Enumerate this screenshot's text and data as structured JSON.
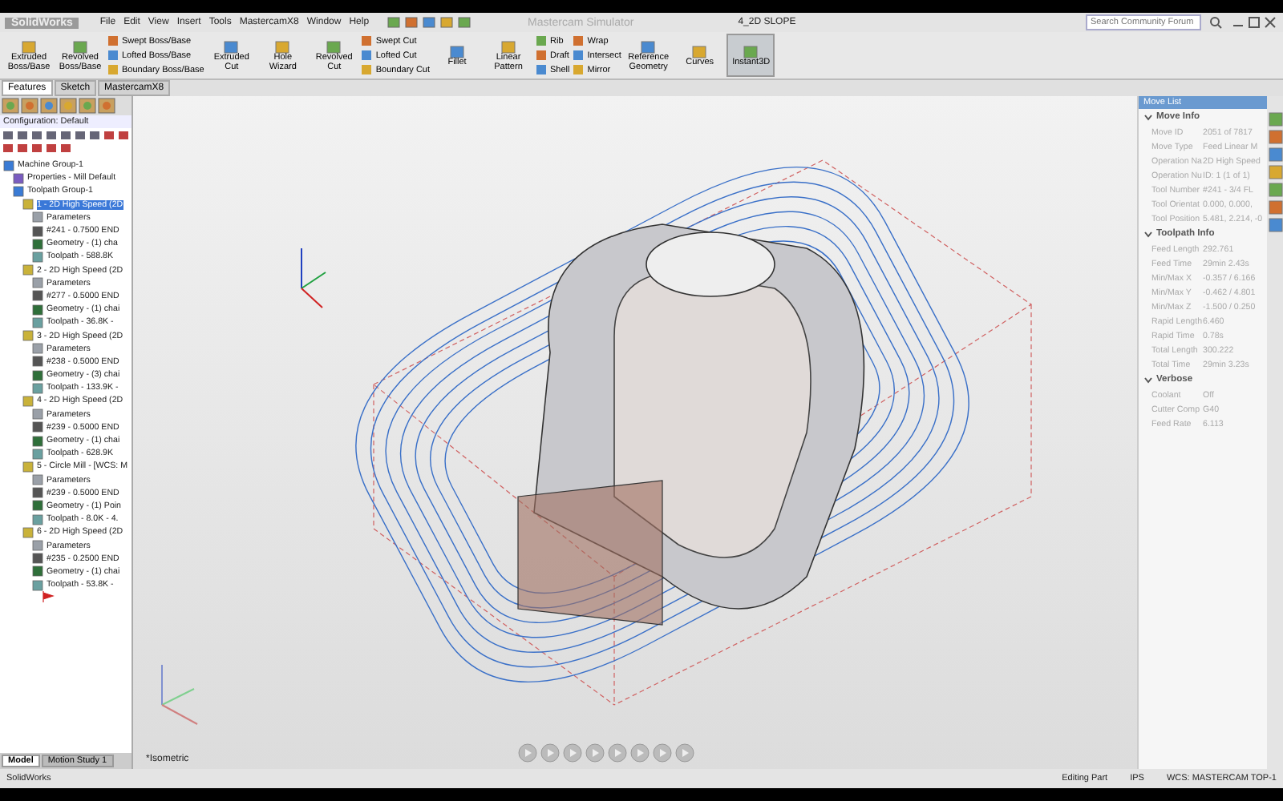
{
  "title_bar": {
    "logo": "SolidWorks",
    "menu": [
      "File",
      "Edit",
      "View",
      "Insert",
      "Tools",
      "MastercamX8",
      "Window",
      "Help"
    ],
    "app_title": "Mastercam Simulator",
    "document": "4_2D SLOPE",
    "search": {
      "placeholder": "Search Community Forum"
    }
  },
  "ribbon": [
    {
      "kind": "large",
      "label": "Extruded Boss/Base",
      "pressed": false
    },
    {
      "kind": "large",
      "label": "Revolved Boss/Base",
      "pressed": false
    },
    {
      "kind": "stack",
      "items": [
        "Swept Boss/Base",
        "Lofted Boss/Base",
        "Boundary Boss/Base"
      ]
    },
    {
      "kind": "large",
      "label": "Extruded Cut",
      "pressed": false
    },
    {
      "kind": "large",
      "label": "Hole Wizard",
      "pressed": false
    },
    {
      "kind": "large",
      "label": "Revolved Cut",
      "pressed": false
    },
    {
      "kind": "stack",
      "items": [
        "Swept Cut",
        "Lofted Cut",
        "Boundary Cut"
      ]
    },
    {
      "kind": "large",
      "label": "Fillet",
      "pressed": false
    },
    {
      "kind": "large",
      "label": "Linear Pattern",
      "pressed": false
    },
    {
      "kind": "stack",
      "items": [
        "Rib",
        "Draft",
        "Shell"
      ]
    },
    {
      "kind": "stack",
      "items": [
        "Wrap",
        "Intersect",
        "Mirror"
      ]
    },
    {
      "kind": "large",
      "label": "Reference Geometry",
      "pressed": false
    },
    {
      "kind": "large",
      "label": "Curves",
      "pressed": false
    },
    {
      "kind": "large",
      "label": "Instant3D",
      "pressed": true
    }
  ],
  "tabs": [
    {
      "label": "Features",
      "selected": true
    },
    {
      "label": "Sketch",
      "selected": false
    },
    {
      "label": "MastercamX8",
      "selected": false
    }
  ],
  "left_panel": {
    "configuration": "Configuration: Default",
    "tree": [
      {
        "kind": "group",
        "label": "Machine Group-1",
        "selected": false,
        "children": [
          {
            "kind": "properties",
            "label": "Properties - Mill Default",
            "selected": false
          },
          {
            "kind": "group",
            "label": "Toolpath Group-1",
            "selected": false,
            "children": [
              {
                "kind": "operation",
                "label": "1 - 2D High Speed (2D",
                "selected": true,
                "children": [
                  {
                    "kind": "parameters",
                    "label": "Parameters",
                    "selected": false
                  },
                  {
                    "kind": "tool",
                    "label": "#241 - 0.7500 END",
                    "selected": false
                  },
                  {
                    "kind": "geometry",
                    "label": "Geometry - (1) cha",
                    "selected": false
                  },
                  {
                    "kind": "toolpath",
                    "label": "Toolpath - 588.8K",
                    "selected": false
                  }
                ]
              },
              {
                "kind": "operation",
                "label": "2 - 2D High Speed (2D",
                "selected": false,
                "children": [
                  {
                    "kind": "parameters",
                    "label": "Parameters",
                    "selected": false
                  },
                  {
                    "kind": "tool",
                    "label": "#277 - 0.5000 END",
                    "selected": false
                  },
                  {
                    "kind": "geometry",
                    "label": "Geometry - (1) chai",
                    "selected": false
                  },
                  {
                    "kind": "toolpath",
                    "label": "Toolpath - 36.8K -",
                    "selected": false
                  }
                ]
              },
              {
                "kind": "operation",
                "label": "3 - 2D High Speed (2D",
                "selected": false,
                "children": [
                  {
                    "kind": "parameters",
                    "label": "Parameters",
                    "selected": false
                  },
                  {
                    "kind": "tool",
                    "label": "#238 - 0.5000 END",
                    "selected": false
                  },
                  {
                    "kind": "geometry",
                    "label": "Geometry - (3) chai",
                    "selected": false
                  },
                  {
                    "kind": "toolpath",
                    "label": "Toolpath - 133.9K -",
                    "selected": false
                  }
                ]
              },
              {
                "kind": "operation",
                "label": "4 - 2D High Speed (2D",
                "selected": false,
                "children": [
                  {
                    "kind": "parameters",
                    "label": "Parameters",
                    "selected": false
                  },
                  {
                    "kind": "tool",
                    "label": "#239 - 0.5000 END",
                    "selected": false
                  },
                  {
                    "kind": "geometry",
                    "label": "Geometry - (1) chai",
                    "selected": false
                  },
                  {
                    "kind": "toolpath",
                    "label": "Toolpath - 628.9K",
                    "selected": false
                  }
                ]
              },
              {
                "kind": "operation",
                "label": "5 - Circle Mill - [WCS: M",
                "selected": false,
                "children": [
                  {
                    "kind": "parameters",
                    "label": "Parameters",
                    "selected": false
                  },
                  {
                    "kind": "tool",
                    "label": "#239 - 0.5000 END",
                    "selected": false
                  },
                  {
                    "kind": "geometry",
                    "label": "Geometry - (1) Poin",
                    "selected": false
                  },
                  {
                    "kind": "toolpath",
                    "label": "Toolpath - 8.0K - 4.",
                    "selected": false
                  }
                ]
              },
              {
                "kind": "operation",
                "label": "6 - 2D High Speed (2D",
                "selected": false,
                "children": [
                  {
                    "kind": "parameters",
                    "label": "Parameters",
                    "selected": false
                  },
                  {
                    "kind": "tool",
                    "label": "#235 - 0.2500 END",
                    "selected": false
                  },
                  {
                    "kind": "geometry",
                    "label": "Geometry - (1) chai",
                    "selected": false
                  },
                  {
                    "kind": "toolpath",
                    "label": "Toolpath - 53.8K -",
                    "selected": false
                  }
                ]
              }
            ]
          }
        ]
      }
    ],
    "bottom_tabs": [
      {
        "label": "Model",
        "selected": true
      },
      {
        "label": "Motion Study 1",
        "selected": false
      }
    ]
  },
  "viewport": {
    "view_label": "*Isometric"
  },
  "move_list": {
    "title": "Move List",
    "sections": [
      {
        "title": "Move Info",
        "expanded": true,
        "rows": [
          [
            "Move ID",
            "2051 of 7817"
          ],
          [
            "Move Type",
            "Feed Linear M"
          ],
          [
            "Operation Na",
            "2D High Speed"
          ],
          [
            "Operation Nu",
            "ID: 1 (1 of 1)"
          ],
          [
            "Tool Number",
            "#241 - 3/4 FL"
          ],
          [
            "Tool Orientat",
            "0.000, 0.000,"
          ],
          [
            "Tool Position",
            "5.481, 2.214, -0"
          ]
        ]
      },
      {
        "title": "Toolpath Info",
        "expanded": true,
        "rows": [
          [
            "Feed Length",
            "292.761"
          ],
          [
            "Feed Time",
            "29min 2.43s"
          ],
          [
            "Min/Max X",
            "-0.357 / 6.166"
          ],
          [
            "Min/Max Y",
            "-0.462 / 4.801"
          ],
          [
            "Min/Max Z",
            "-1.500 / 0.250"
          ],
          [
            "Rapid Length",
            "6.460"
          ],
          [
            "Rapid Time",
            "0.78s"
          ],
          [
            "Total Length",
            "300.222"
          ],
          [
            "Total Time",
            "29min 3.23s"
          ]
        ]
      },
      {
        "title": "Verbose",
        "expanded": true,
        "rows": [
          [
            "Coolant",
            "Off"
          ],
          [
            "Cutter Comp",
            "G40"
          ],
          [
            "Feed Rate",
            "6.113"
          ]
        ]
      }
    ]
  },
  "status_bar": {
    "app": "SolidWorks",
    "mode": "Editing Part",
    "units": "IPS",
    "wcs": "WCS: MASTERCAM TOP-1"
  }
}
